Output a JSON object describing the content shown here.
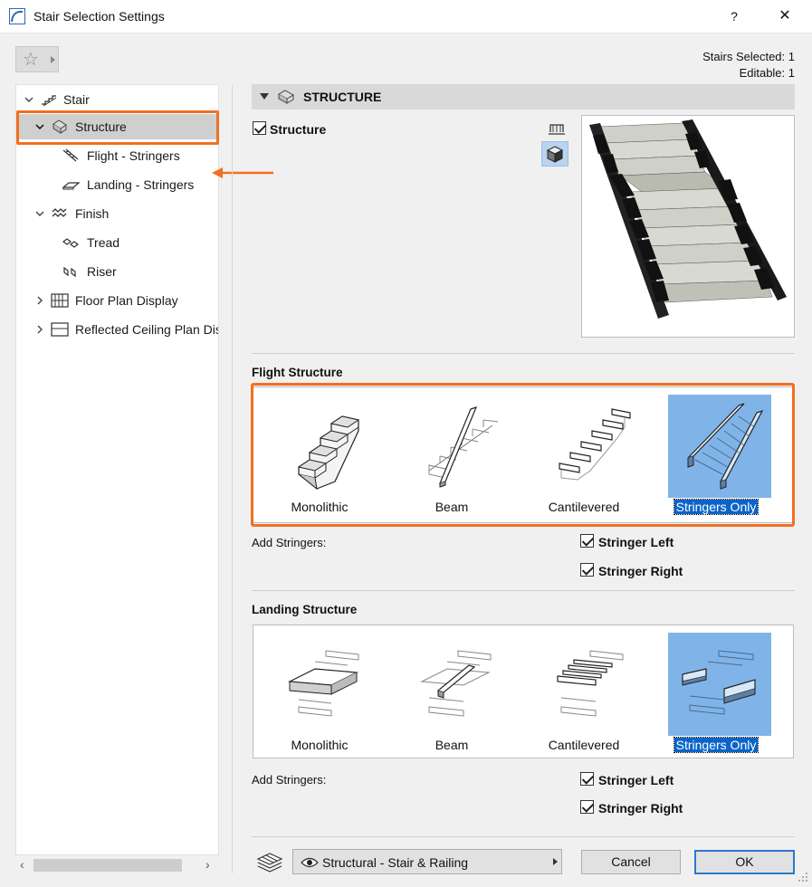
{
  "window": {
    "title": "Stair Selection Settings",
    "help_label": "?",
    "close_label": "✕"
  },
  "favorites": {
    "star_icon": "star-icon"
  },
  "selection": {
    "selected": "Stairs Selected: 1",
    "editable": "Editable: 1"
  },
  "tree": {
    "items": [
      {
        "label": "Stair",
        "icon": "stair-icon"
      },
      {
        "label": "Structure",
        "icon": "structure-icon"
      },
      {
        "label": "Flight - Stringers",
        "icon": "flight-stringers-icon"
      },
      {
        "label": "Landing - Stringers",
        "icon": "landing-stringers-icon"
      },
      {
        "label": "Finish",
        "icon": "finish-icon"
      },
      {
        "label": "Tread",
        "icon": "tread-icon"
      },
      {
        "label": "Riser",
        "icon": "riser-icon"
      },
      {
        "label": "Floor Plan Display",
        "icon": "floor-plan-icon"
      },
      {
        "label": "Reflected Ceiling Plan Display",
        "icon": "ceiling-plan-icon"
      }
    ]
  },
  "section": {
    "title": "STRUCTURE",
    "structure_checkbox_label": "Structure",
    "structure_checked": true
  },
  "flight": {
    "title": "Flight Structure",
    "options": [
      {
        "label": "Monolithic",
        "selected": false
      },
      {
        "label": "Beam",
        "selected": false
      },
      {
        "label": "Cantilevered",
        "selected": false
      },
      {
        "label": "Stringers Only",
        "selected": true
      }
    ],
    "add_stringers_label": "Add Stringers:",
    "stringer_left_label": "Stringer Left",
    "stringer_right_label": "Stringer Right"
  },
  "landing": {
    "title": "Landing Structure",
    "options": [
      {
        "label": "Monolithic",
        "selected": false
      },
      {
        "label": "Beam",
        "selected": false
      },
      {
        "label": "Cantilevered",
        "selected": false
      },
      {
        "label": "Stringers Only",
        "selected": true
      }
    ],
    "add_stringers_label": "Add Stringers:",
    "stringer_left_label": "Stringer Left",
    "stringer_right_label": "Stringer Right"
  },
  "footer": {
    "layer_label": "Structural - Stair & Railing",
    "cancel_label": "Cancel",
    "ok_label": "OK"
  },
  "colors": {
    "highlight": "#f07020",
    "selection_blue": "#80b4e8",
    "selected_label": "#0a64c8"
  }
}
